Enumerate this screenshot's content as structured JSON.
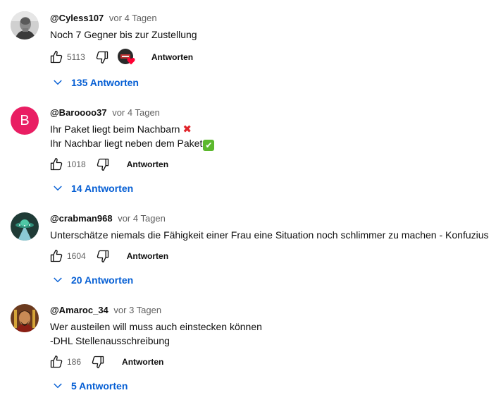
{
  "comments": [
    {
      "author": "@Cyless107",
      "time": "vor 4 Tagen",
      "lines": [
        "Noch 7 Gegner bis zur Zustellung"
      ],
      "likes": "5113",
      "creator_heart": true,
      "reply_label": "Antworten",
      "replies_label": "135 Antworten",
      "avatar": "photo-grayscale"
    },
    {
      "author": "@Baroooo37",
      "time": "vor 4 Tagen",
      "lines": [
        "Ihr Paket liegt beim Nachbarn",
        "Ihr Nachbar liegt neben dem Paket"
      ],
      "likes": "1018",
      "reply_label": "Antworten",
      "replies_label": "14 Antworten",
      "avatar_letter": "B",
      "avatar_color": "#e91e63"
    },
    {
      "author": "@crabman968",
      "time": "vor 4 Tagen",
      "lines": [
        "Unterschätze niemals die Fähigkeit einer Frau eine Situation noch schlimmer zu machen - Konfuzius"
      ],
      "likes": "1604",
      "reply_label": "Antworten",
      "replies_label": "20 Antworten",
      "avatar": "ufo-icon"
    },
    {
      "author": "@Amaroc_34",
      "time": "vor 3 Tagen",
      "lines": [
        "Wer austeilen will muss auch einstecken können",
        "-DHL Stellenausschreibung"
      ],
      "likes": "186",
      "reply_label": "Antworten",
      "replies_label": "5 Antworten",
      "avatar": "warrior-portrait"
    }
  ],
  "icons": {
    "like": "thumbs-up-icon",
    "dislike": "thumbs-down-icon",
    "expand": "chevron-down-icon",
    "heart": "heart-icon",
    "cross_emoji": "cross-mark-emoji",
    "check_emoji": "check-mark-emoji"
  },
  "colors": {
    "link_blue": "#065fd4",
    "heart_red": "#ff0033",
    "meta_gray": "#606060"
  }
}
